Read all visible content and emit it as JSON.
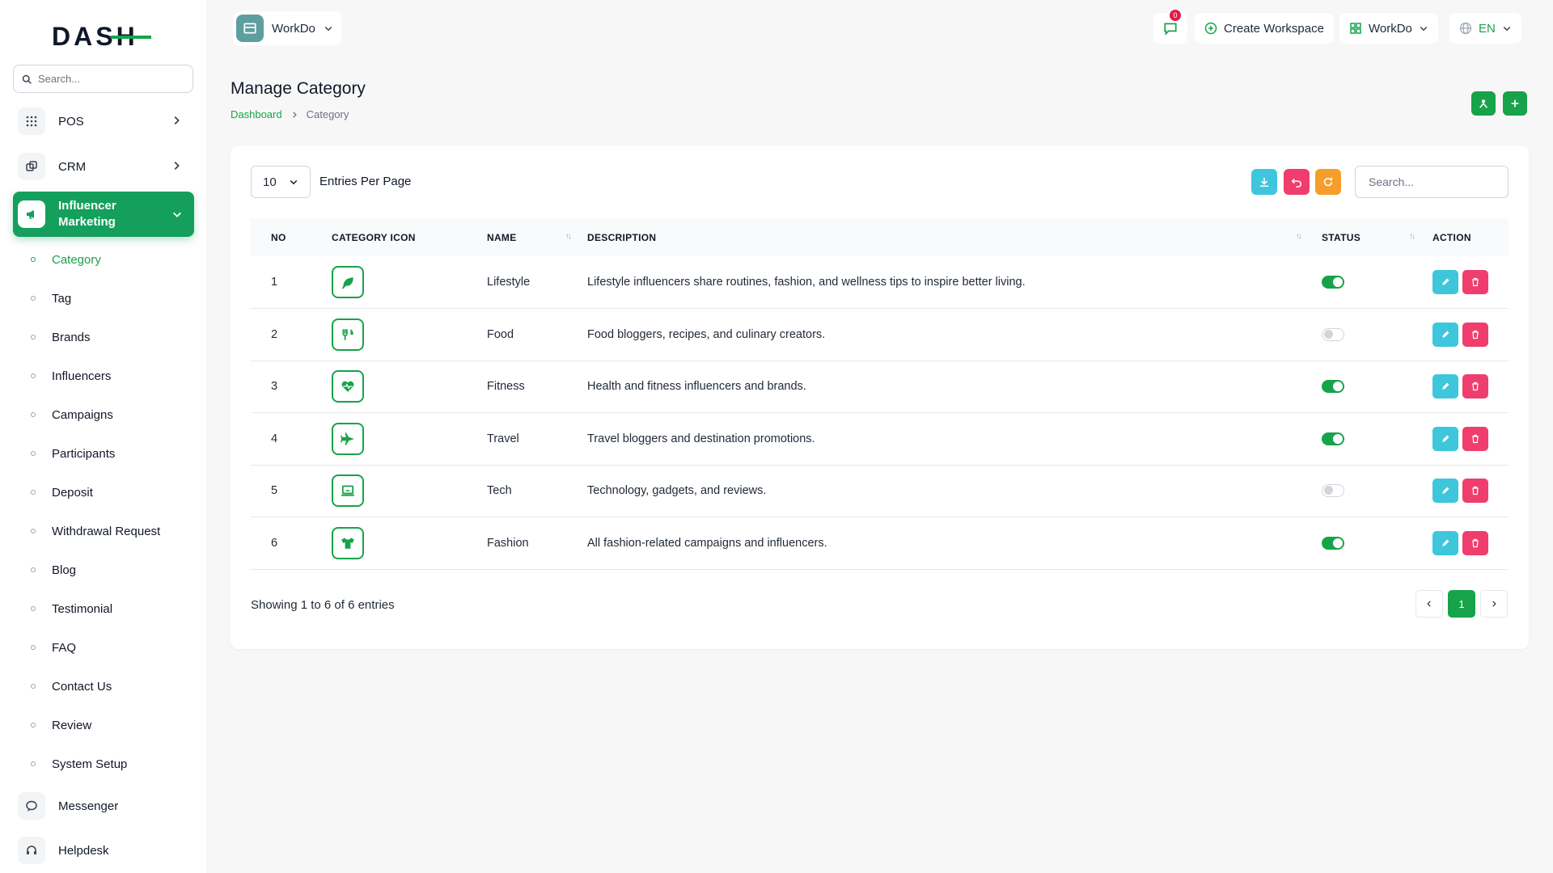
{
  "brand": {
    "logo_text": "DASH",
    "accent": "#16a34a"
  },
  "sidebar": {
    "search_placeholder": "Search...",
    "top_items": [
      {
        "label": "POS",
        "icon": "grid-icon"
      },
      {
        "label": "CRM",
        "icon": "layers-icon"
      }
    ],
    "active_group": {
      "label": "Influencer Marketing",
      "icon": "megaphone-icon"
    },
    "sub_items": [
      "Category",
      "Tag",
      "Brands",
      "Influencers",
      "Campaigns",
      "Participants",
      "Deposit",
      "Withdrawal Request",
      "Blog",
      "Testimonial",
      "FAQ",
      "Contact Us",
      "Review",
      "System Setup"
    ],
    "bottom_items": [
      {
        "label": "Messenger",
        "icon": "chat-icon"
      },
      {
        "label": "Helpdesk",
        "icon": "headset-icon"
      }
    ]
  },
  "topbar": {
    "workspace": "WorkDo",
    "notification_count": "0",
    "create_workspace": "Create Workspace",
    "workspace_switch": "WorkDo",
    "language": "EN"
  },
  "page": {
    "title": "Manage Category",
    "breadcrumb_home": "Dashboard",
    "breadcrumb_current": "Category"
  },
  "table_controls": {
    "per_page": "10",
    "per_page_label": "Entries Per Page",
    "search_placeholder": "Search..."
  },
  "table": {
    "headers": [
      "NO",
      "CATEGORY ICON",
      "NAME",
      "DESCRIPTION",
      "STATUS",
      "ACTION"
    ],
    "rows": [
      {
        "no": "1",
        "icon": "leaf-icon",
        "name": "Lifestyle",
        "description": "Lifestyle influencers share routines, fashion, and wellness tips to inspire better living.",
        "status": true
      },
      {
        "no": "2",
        "icon": "utensils-icon",
        "name": "Food",
        "description": "Food bloggers, recipes, and culinary creators.",
        "status": false
      },
      {
        "no": "3",
        "icon": "heartbeat-icon",
        "name": "Fitness",
        "description": "Health and fitness influencers and brands.",
        "status": true
      },
      {
        "no": "4",
        "icon": "plane-icon",
        "name": "Travel",
        "description": "Travel bloggers and destination promotions.",
        "status": true
      },
      {
        "no": "5",
        "icon": "laptop-icon",
        "name": "Tech",
        "description": "Technology, gadgets, and reviews.",
        "status": false
      },
      {
        "no": "6",
        "icon": "tshirt-icon",
        "name": "Fashion",
        "description": "All fashion-related campaigns and influencers.",
        "status": true
      }
    ]
  },
  "footer": {
    "showing": "Showing 1 to 6 of 6 entries",
    "current_page": "1"
  }
}
